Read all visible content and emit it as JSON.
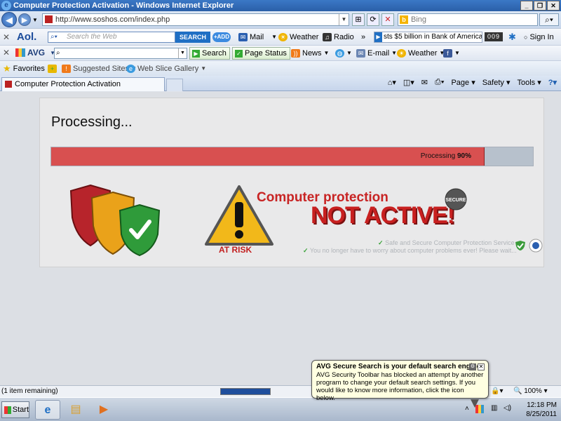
{
  "window": {
    "title": "Computer Protection Activation - Windows Internet Explorer"
  },
  "address_bar": {
    "url": "http://www.soshos.com/index.php",
    "search_placeholder": "Bing"
  },
  "aol_toolbar": {
    "logo": "Aol.",
    "search_placeholder": "Search the Web",
    "search_button": "SEARCH",
    "add_button": "+ADD",
    "mail": "Mail",
    "weather": "Weather",
    "radio": "Radio",
    "ticker": "sts $5 billion in Bank of America ...",
    "ticker_count": "009",
    "sign_in": "Sign In"
  },
  "avg_toolbar": {
    "logo": "AVG",
    "search_button": "Search",
    "page_status": "Page Status",
    "news": "News",
    "email": "E-mail",
    "weather": "Weather"
  },
  "favorites_bar": {
    "favorites": "Favorites",
    "suggested_sites": "Suggested Sites",
    "web_slice": "Web Slice Gallery"
  },
  "tabs": {
    "active_tab": "Computer Protection Activation"
  },
  "command_bar": {
    "page": "Page",
    "safety": "Safety",
    "tools": "Tools"
  },
  "page": {
    "heading": "Processing...",
    "progress_label": "Processing",
    "progress_value": "90%",
    "progress_fraction": 0.9,
    "at_risk": "AT RISK",
    "cp_line1": "Computer protection",
    "cp_line2": "NOT ACTIVE!",
    "seal_text": "SECURE",
    "service_line1": "Safe and Secure Computer Protection Service",
    "service_line2": "You no longer have to worry about computer problems ever! Please wait..."
  },
  "status_bar": {
    "text": "(1 item remaining)",
    "zoom": "100%"
  },
  "balloon": {
    "title": "AVG Secure Search is your default search engine",
    "body": "AVG Security Toolbar has blocked an attempt by another program to change your default search settings. If you would like to know more information, click the icon below."
  },
  "taskbar": {
    "start": "Start",
    "time": "12:18 PM",
    "date": "8/25/2011"
  },
  "colors": {
    "progress_fill": "#d85050",
    "progress_track": "#b7c1cc",
    "alert_red": "#c82424"
  }
}
